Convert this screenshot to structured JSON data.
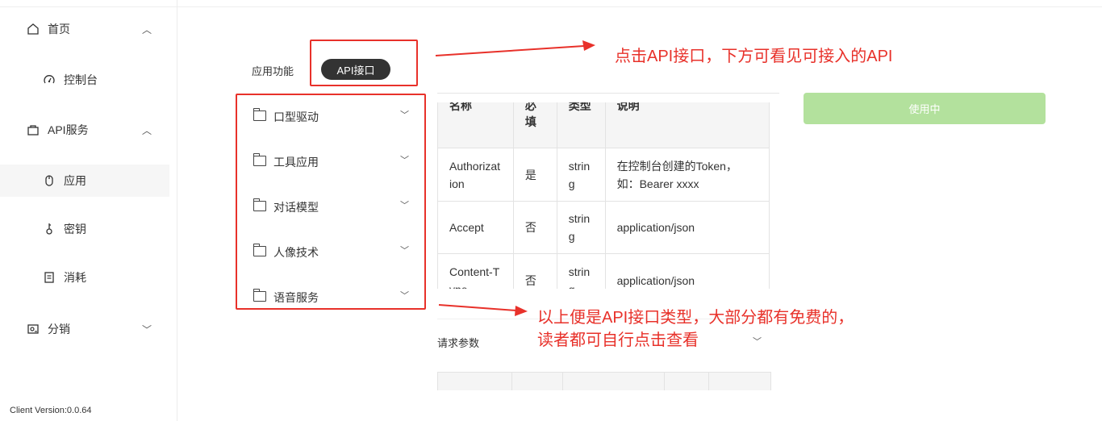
{
  "sidebar": {
    "items": [
      {
        "label": "首页",
        "icon": "home-icon",
        "chevron": "up"
      },
      {
        "label": "控制台",
        "icon": "dashboard-icon"
      },
      {
        "label": "API服务",
        "icon": "bag-icon",
        "chevron": "up"
      },
      {
        "label": "应用",
        "icon": "mouse-icon"
      },
      {
        "label": "密钥",
        "icon": "key-icon"
      },
      {
        "label": "消耗",
        "icon": "document-icon"
      },
      {
        "label": "分销",
        "icon": "distribution-icon",
        "chevron": "down"
      }
    ],
    "version": "Client Version:0.0.64"
  },
  "tabs": {
    "plain": "应用功能",
    "active": "API接口"
  },
  "categories": [
    "口型驱动",
    "工具应用",
    "对话模型",
    "人像技术",
    "语音服务"
  ],
  "params_table": {
    "headers": [
      "名称",
      "必填",
      "类型",
      "说明"
    ],
    "rows": [
      [
        "Authorization",
        "是",
        "string",
        "在控制台创建的Token，如：Bearer xxxx"
      ],
      [
        "Accept",
        "否",
        "string",
        "application/json"
      ],
      [
        "Content-Type",
        "否",
        "string",
        "application/json"
      ]
    ]
  },
  "use_button": "使用中",
  "request_params": "请求参数",
  "annotations": {
    "note1": "点击API接口，下方可看见可接入的API",
    "note2_line1": "以上便是API接口类型，大部分都有免费的，",
    "note2_line2": "读者都可自行点击查看",
    "color": "#e8312a"
  },
  "colors": {
    "accent_dark": "#333333",
    "use_button_bg": "#b3e19d"
  }
}
